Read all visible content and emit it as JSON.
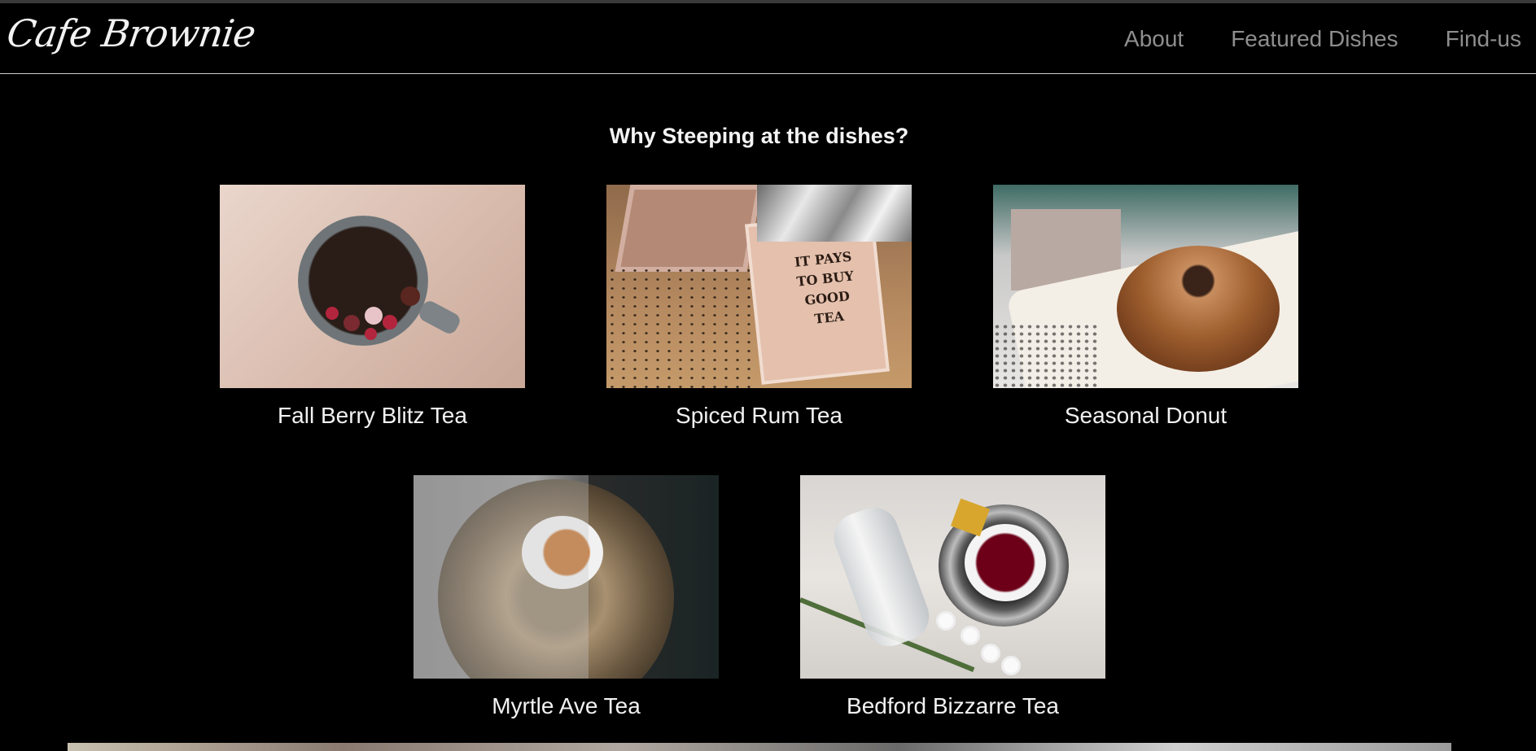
{
  "header": {
    "brand": "Cafe Brownie",
    "nav": [
      "About",
      "Featured Dishes",
      "Find-us"
    ]
  },
  "section": {
    "heading": "Why Steeping at the dishes?",
    "items": [
      {
        "caption": "Fall Berry Blitz Tea",
        "image": "berry-tea-mug-photo"
      },
      {
        "caption": "Spiced Rum Tea",
        "image": "tea-box-photo",
        "image_text": [
          "IT PAYS",
          "TO BUY",
          "GOOD",
          "TEA"
        ]
      },
      {
        "caption": "Seasonal Donut",
        "image": "donut-photo"
      },
      {
        "caption": "Myrtle Ave Tea",
        "image": "tea-cup-on-tray-photo"
      },
      {
        "caption": "Bedford Bizzarre Tea",
        "image": "red-tea-cup-photo"
      }
    ]
  },
  "colors": {
    "background": "#000000",
    "nav_text": "#8e8e8e",
    "text": "#f2f2f2",
    "divider": "#cfcfcf"
  }
}
